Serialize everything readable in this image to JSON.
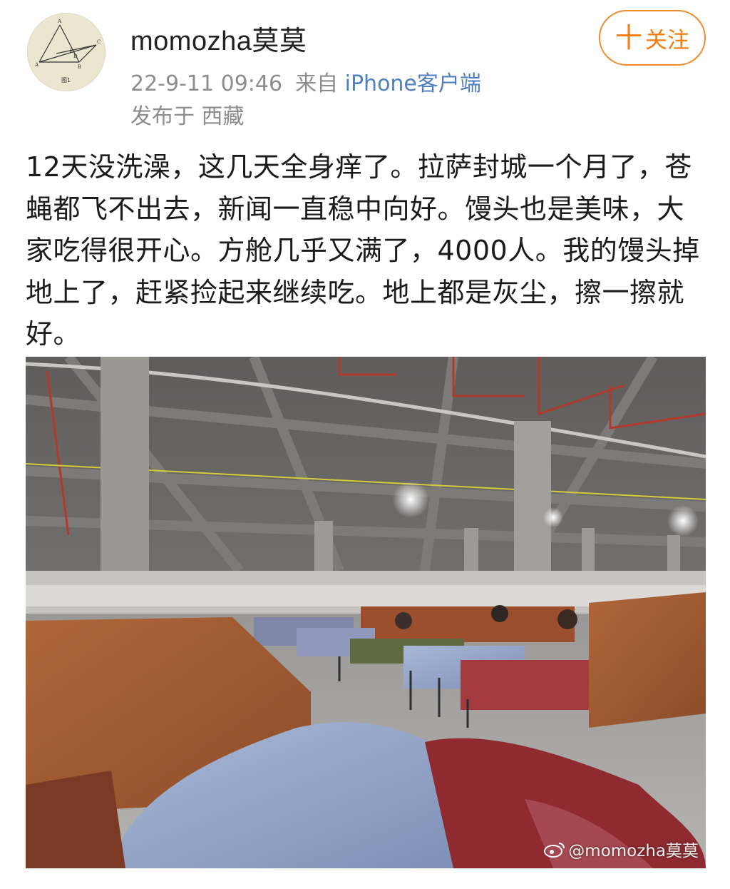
{
  "author": {
    "username": "momozha莫莫",
    "avatar_icon": "geometry-diagram-avatar",
    "avatar_caption": "图1"
  },
  "follow_button": {
    "plus": "十",
    "label": "关注"
  },
  "meta": {
    "timestamp": "22-9-11 09:46",
    "source_prefix": "来自",
    "source_app": "iPhone客户端",
    "location": "发布于 西藏"
  },
  "post": {
    "text": "12天没洗澡，这几天全身痒了。拉萨封城一个月了，苍蝇都飞不出去，新闻一直稳中向好。馒头也是美味，大家吃得很开心。方舱几乎又满了，4000人。我的馒头掉地上了，赶紧捡起来继续吃。地上都是灰尘，擦一擦就好。"
  },
  "photo": {
    "subject": "crowded quarantine facility hall with beds and blankets",
    "watermark": "@momozha莫莫",
    "watermark_icon": "weibo-icon"
  },
  "colors": {
    "accent_orange": "#f27c10",
    "link_blue": "#4e7fc0",
    "meta_gray": "#8d8d8d"
  }
}
